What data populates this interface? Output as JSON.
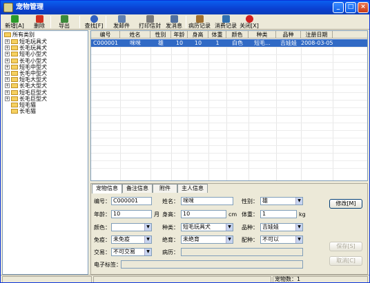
{
  "window": {
    "title": "宠物管理"
  },
  "toolbar": [
    {
      "label": "新增[A]",
      "icon": "add-icon",
      "color": "#2a9a2a"
    },
    {
      "label": "删除",
      "icon": "delete-icon",
      "color": "#d03020"
    },
    {
      "label": "导出",
      "icon": "export-icon",
      "color": "#3a8a3a"
    },
    {
      "label": "查找[F]",
      "icon": "find-icon",
      "color": "#3060c0"
    },
    {
      "label": "发邮件",
      "icon": "mail-icon",
      "color": "#6080b0"
    },
    {
      "label": "打印信封",
      "icon": "print-icon",
      "color": "#7a7a7a"
    },
    {
      "label": "发消息",
      "icon": "message-icon",
      "color": "#5070a0"
    },
    {
      "label": "病历记录",
      "icon": "record-icon",
      "color": "#a07030"
    },
    {
      "label": "消费记录",
      "icon": "consume-icon",
      "color": "#3070b0"
    },
    {
      "label": "关闭[X]",
      "icon": "close-icon",
      "color": "#d02020"
    }
  ],
  "tree": {
    "root": "所有类别",
    "items": [
      {
        "label": "短毛玩具犬",
        "expandable": true
      },
      {
        "label": "长毛玩具犬",
        "expandable": true
      },
      {
        "label": "短毛小型犬",
        "expandable": true
      },
      {
        "label": "长毛小型犬",
        "expandable": true
      },
      {
        "label": "短毛中型犬",
        "expandable": true
      },
      {
        "label": "长毛中型犬",
        "expandable": true
      },
      {
        "label": "短毛大型犬",
        "expandable": true
      },
      {
        "label": "长毛大型犬",
        "expandable": true
      },
      {
        "label": "短毛巨型犬",
        "expandable": true
      },
      {
        "label": "长毛巨型犬",
        "expandable": true
      },
      {
        "label": "短毛猫",
        "expandable": false
      },
      {
        "label": "长毛猫",
        "expandable": false
      }
    ]
  },
  "grid": {
    "columns": [
      "编号",
      "姓名",
      "性别",
      "年龄",
      "身高",
      "体重",
      "颜色",
      "种类",
      "品种",
      "注册日期"
    ],
    "rows": [
      [
        "C000001",
        "咪咪",
        "雄",
        "10",
        "10",
        "1",
        "白色",
        "短毛...",
        "吉娃娃",
        "2008-03-05"
      ]
    ]
  },
  "detail": {
    "tabs": [
      "宠物信息",
      "备注信息",
      "附件",
      "主人信息"
    ],
    "labels": {
      "id": "编号：",
      "name": "姓名：",
      "sex": "性别：",
      "age": "年龄：",
      "height": "身高：",
      "weight": "体重：",
      "color": "颜色：",
      "kind": "种类：",
      "breed": "品种：",
      "immune": "免疫：",
      "neuter": "绝育：",
      "mate": "配种：",
      "trade": "交易：",
      "history": "病历：",
      "tag": "电子标签："
    },
    "values": {
      "id": "C000001",
      "name": "咪咪",
      "sex": "雄",
      "age": "10",
      "height": "10",
      "weight": "1",
      "color": "",
      "kind": "短毛玩具犬",
      "breed": "吉娃娃",
      "immune": "未免疫",
      "neuter": "未绝育",
      "mate": "不可以",
      "trade": "不可交易",
      "history": "",
      "tag": ""
    },
    "units": {
      "age": "月",
      "height": "cm",
      "weight": "kg"
    },
    "buttons": {
      "edit": "修改[M]",
      "save": "保存[S]",
      "cancel": "取消[C]"
    }
  },
  "status": {
    "count": "宠物数：1"
  }
}
